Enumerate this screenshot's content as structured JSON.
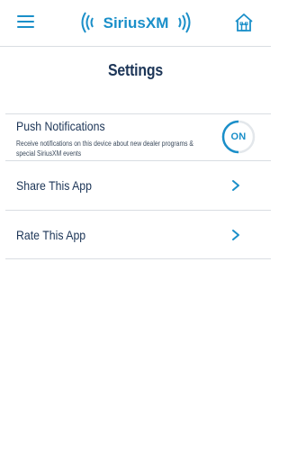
{
  "header": {
    "menu_icon": "hamburger-menu-icon",
    "logo_text": "SiriusXM",
    "home_icon": "home-icon"
  },
  "page": {
    "title": "Settings"
  },
  "settings": {
    "push": {
      "title": "Push Notifications",
      "description": "Receive notifications on this device about new dealer programs & special SiriusXM events",
      "toggle_label": "ON",
      "toggle_state": true
    },
    "share": {
      "title": "Share This App",
      "icon": "chevron-right-icon"
    },
    "rate": {
      "title": "Rate This App",
      "icon": "chevron-right-icon"
    }
  },
  "colors": {
    "accent": "#1a8fc9",
    "text": "#1c3557",
    "divider": "#d9dde2"
  }
}
